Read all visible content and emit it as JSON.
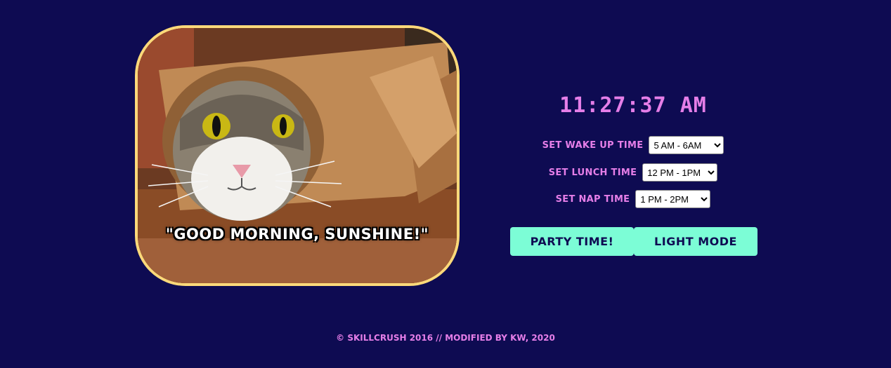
{
  "photo": {
    "caption": "\"GOOD MORNING, SUNSHINE!\"",
    "subject": "cat-in-paper-roll"
  },
  "clock": {
    "time": "11:27:37 AM"
  },
  "settings": {
    "wakeup": {
      "label": "SET WAKE UP TIME",
      "selected": "5 AM - 6AM"
    },
    "lunch": {
      "label": "SET LUNCH TIME",
      "selected": "12 PM - 1PM"
    },
    "nap": {
      "label": "SET NAP TIME",
      "selected": "1 PM - 2PM"
    }
  },
  "buttons": {
    "party": "PARTY TIME!",
    "light": "LIGHT MODE"
  },
  "footer": {
    "text": "© SKILLCRUSH 2016 // MODIFIED BY KW, 2020"
  },
  "colors": {
    "background": "#0e0b52",
    "accent": "#e57ee8",
    "button": "#7cfdd6",
    "frame": "#fcd97a"
  }
}
